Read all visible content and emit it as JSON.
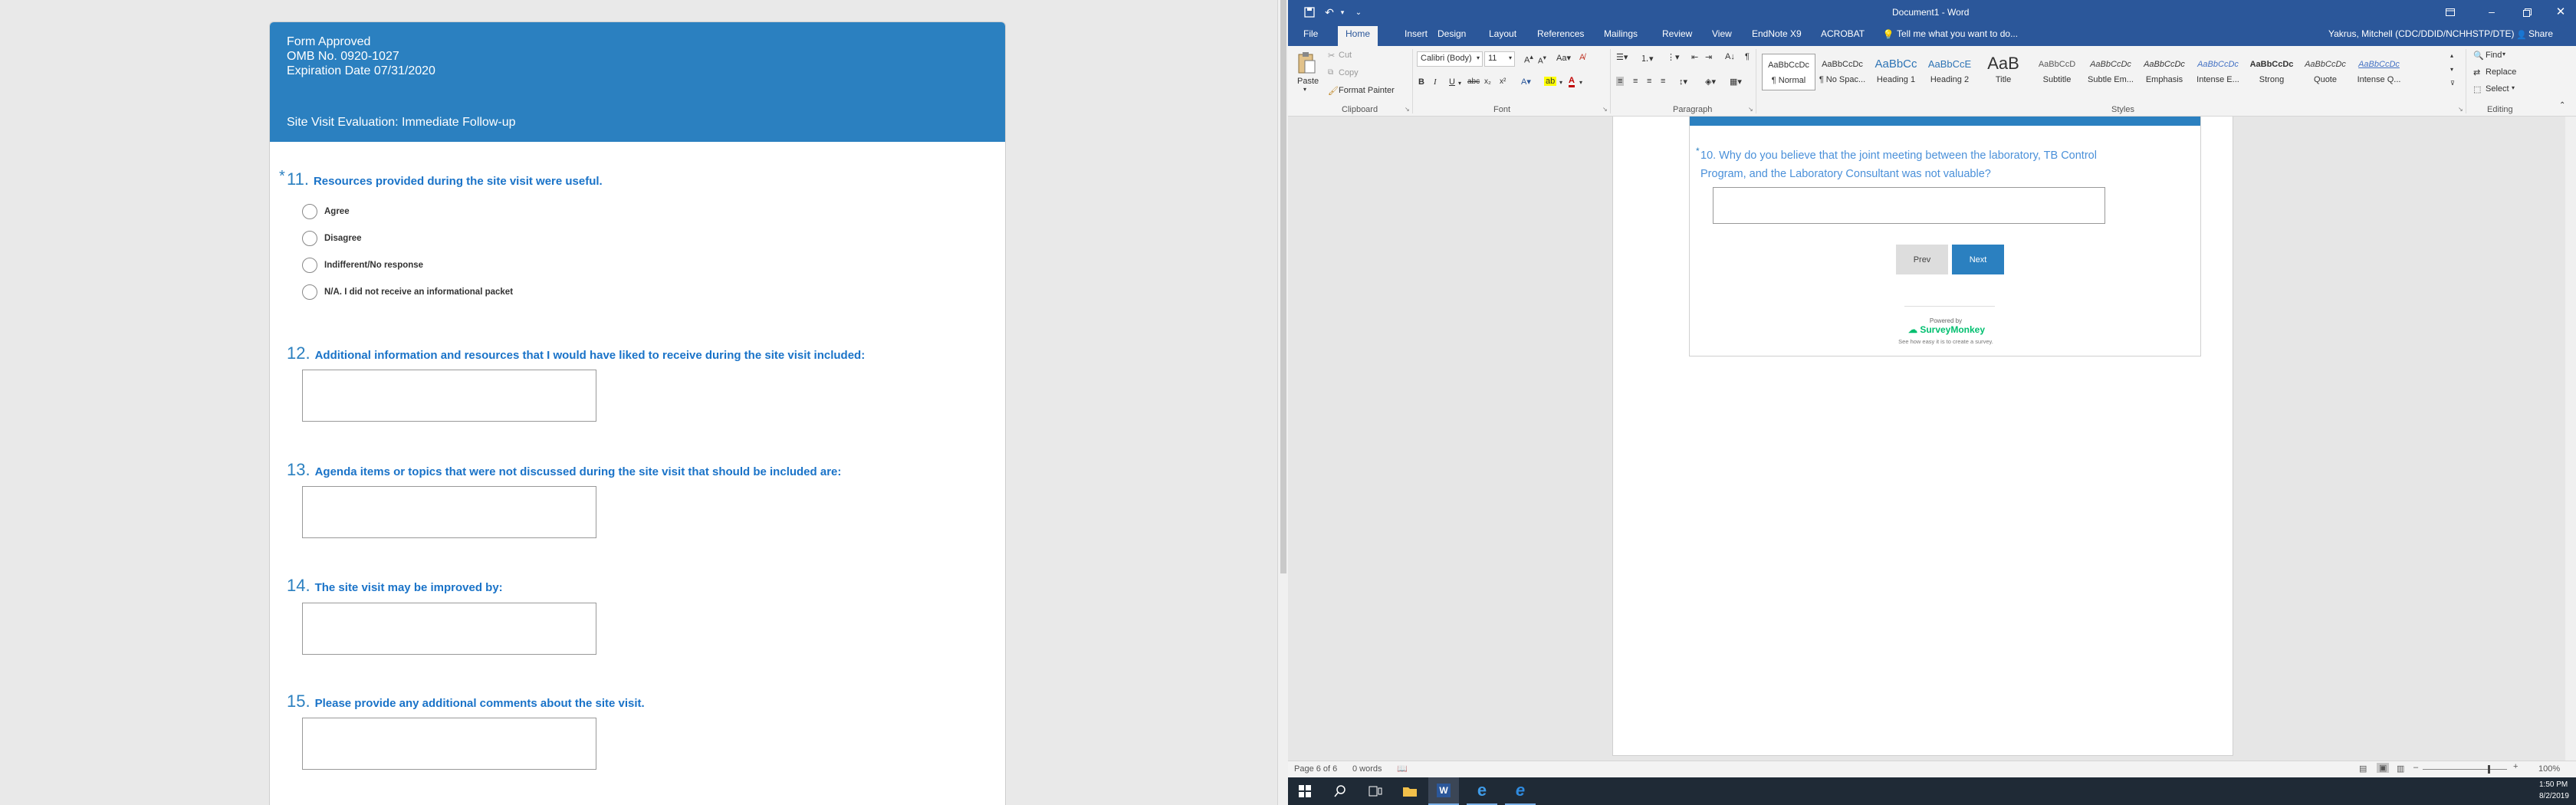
{
  "survey": {
    "header": {
      "line1": "Form Approved",
      "line2": "OMB No. 0920-1027",
      "line3": "Expiration Date 07/31/2020",
      "title": "Site Visit Evaluation: Immediate Follow-up"
    },
    "required_mark": "*",
    "questions": [
      {
        "num": "11.",
        "text": "Resources provided during the site visit were useful."
      },
      {
        "num": "12.",
        "text": "Additional information and resources that I would have liked to receive during the site visit included:"
      },
      {
        "num": "13.",
        "text": "Agenda items or topics that were not discussed during the site visit that should be included are:"
      },
      {
        "num": "14.",
        "text": "The site visit may be improved by:"
      },
      {
        "num": "15.",
        "text": "Please provide any additional comments about the site visit."
      }
    ],
    "options": [
      "Agree",
      "Disagree",
      "Indifferent/No response",
      "N/A. I did not receive an informational packet"
    ]
  },
  "word": {
    "title": "Document1 - Word",
    "user": "Yakrus, Mitchell (CDC/DDID/NCHHSTP/DTE)",
    "share": "Share",
    "tabs": [
      "File",
      "Home",
      "Insert",
      "Design",
      "Layout",
      "References",
      "Mailings",
      "Review",
      "View",
      "EndNote X9",
      "ACROBAT"
    ],
    "tell_me": "Tell me what you want to do...",
    "clipboard": {
      "paste": "Paste",
      "cut": "Cut",
      "copy": "Copy",
      "format_painter": "Format Painter",
      "group": "Clipboard"
    },
    "font": {
      "name": "Calibri (Body)",
      "size": "11",
      "group": "Font"
    },
    "paragraph_group": "Paragraph",
    "styles_group": "Styles",
    "editing": {
      "find": "Find",
      "replace": "Replace",
      "select": "Select",
      "group": "Editing"
    },
    "styles": [
      {
        "preview": "AaBbCcDc",
        "name": "¶ Normal"
      },
      {
        "preview": "AaBbCcDc",
        "name": "¶ No Spac..."
      },
      {
        "preview": "AaBbCc",
        "name": "Heading 1"
      },
      {
        "preview": "AaBbCcE",
        "name": "Heading 2"
      },
      {
        "preview": "AaB",
        "name": "Title"
      },
      {
        "preview": "AaBbCcD",
        "name": "Subtitle"
      },
      {
        "preview": "AaBbCcDc",
        "name": "Subtle Em..."
      },
      {
        "preview": "AaBbCcDc",
        "name": "Emphasis"
      },
      {
        "preview": "AaBbCcDc",
        "name": "Intense E..."
      },
      {
        "preview": "AaBbCcDc",
        "name": "Strong"
      },
      {
        "preview": "AaBbCcDc",
        "name": "Quote"
      },
      {
        "preview": "AaBbCcDc",
        "name": "Intense Q..."
      }
    ],
    "embedded_question": {
      "mark": "*",
      "line1": "10. Why do you believe that the joint meeting between the laboratory, TB Control",
      "line2": "Program, and the Laboratory Consultant was not valuable?"
    },
    "prev_label": "Prev",
    "next_label": "Next",
    "powered_by": "Powered by",
    "brand": "SurveyMonkey",
    "tagline": "See how easy it is to create a survey.",
    "status": {
      "page": "Page 6 of 6",
      "words": "0 words",
      "zoom": "100%"
    }
  },
  "taskbar": {
    "time": "1:50 PM",
    "date": "8/2/2019"
  },
  "colors": {
    "survey_blue": "#2b80c0",
    "word_blue": "#2b579a",
    "question_text": "#1a73c8",
    "taskbar": "#1f2a36"
  }
}
